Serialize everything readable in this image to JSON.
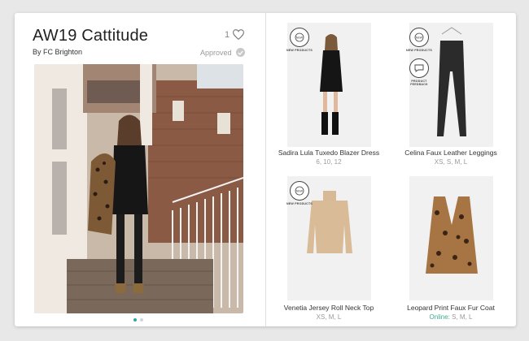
{
  "lookbook": {
    "title": "AW19 Cattitude",
    "author": "By FC Brighton",
    "likes": "1",
    "status": "Approved"
  },
  "carousel": {
    "count": 2,
    "active": 0
  },
  "badges": {
    "new_products": "NEW PRODUCTS",
    "product_feedback": "PRODUCT FEEDBACK"
  },
  "products": [
    {
      "name": "Sadira Lula Tuxedo Blazer Dress",
      "sizes": "6, 10, 12"
    },
    {
      "name": "Celina Faux Leather Leggings",
      "sizes": "XS, S, M, L"
    },
    {
      "name": "Venetia Jersey Roll Neck Top",
      "sizes": "XS, M, L"
    },
    {
      "name": "Leopard Print Faux Fur Coat",
      "online_label": "Online:",
      "sizes": "S, M, L"
    }
  ],
  "colors": {
    "accent": "#35a3a6",
    "online": "#3aaa8c"
  }
}
